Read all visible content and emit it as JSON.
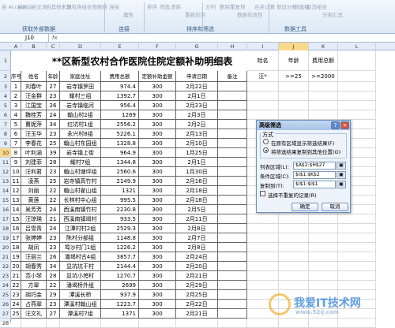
{
  "ribbon": {
    "row1": [
      "自 Access",
      "自网站",
      "自文本",
      "自其他来源",
      "现有连接",
      "全部刷新",
      "连接",
      "属性",
      "排序",
      "筛选",
      "清除",
      "重新应用",
      "分列",
      "删除重复项",
      "数据有效性",
      "合并计算",
      "假设分析",
      "创建组",
      "取消组合",
      "分类汇总"
    ],
    "groups": [
      "获取外部数据",
      "连接",
      "排序和筛选",
      "数据工具"
    ]
  },
  "formula_bar": {
    "name_box": "J10",
    "fx": "fx"
  },
  "columns": [
    "A",
    "B",
    "C",
    "D",
    "E",
    "F",
    "G",
    "H",
    "I",
    "J",
    "K",
    "L"
  ],
  "rows": [
    "1",
    "2",
    "3",
    "4",
    "5",
    "6",
    "7",
    "8",
    "9",
    "10",
    "11",
    "12",
    "13",
    "14",
    "15",
    "16",
    "17",
    "18",
    "19",
    "20",
    "21",
    "22",
    "23",
    "24",
    "25",
    "26",
    "27",
    "28"
  ],
  "sheet_title": "**区新型农村合作医院住院定额补助明细表",
  "table_headers": [
    "序号",
    "姓名",
    "年龄",
    "家庭住址",
    "费用总额",
    "定额补助金额",
    "申请日期",
    "备注"
  ],
  "table_rows": [
    [
      "1",
      "刘春叶",
      "27",
      "岩寺镇罗田",
      "974.4",
      "300",
      "2月22日",
      ""
    ],
    [
      "2",
      "汪金群",
      "23",
      "耀村三组",
      "1392.7",
      "300",
      "2月1日",
      ""
    ],
    [
      "3",
      "江国宝",
      "26",
      "岩寺镇临河",
      "956.4",
      "300",
      "2月23日",
      ""
    ],
    [
      "4",
      "魏桂芳",
      "24",
      "翰山村2组",
      "1269",
      "300",
      "2月3日",
      ""
    ],
    [
      "5",
      "曹妮萍",
      "34",
      "红坑村1组",
      "2556.2",
      "300",
      "2月2日",
      ""
    ],
    [
      "6",
      "汪玉华",
      "23",
      "永兴村8组",
      "5226.1",
      "300",
      "2月13日",
      ""
    ],
    [
      "7",
      "李春花",
      "25",
      "翰山村东园组",
      "1328.8",
      "300",
      "2月10日",
      ""
    ],
    [
      "8",
      "叶利涵",
      "39",
      "岩寺镇上街",
      "964.9",
      "300",
      "1月25日",
      ""
    ],
    [
      "9",
      "刘建菲",
      "28",
      "耀村7组",
      "1344.8",
      "300",
      "2月1日",
      ""
    ],
    [
      "10",
      "汪利君",
      "23",
      "翰山村塘坪组",
      "2560.6",
      "300",
      "1月30日",
      ""
    ],
    [
      "11",
      "凌燕",
      "25",
      "岩寺镇高竹村",
      "2149.9",
      "300",
      "2月16日",
      ""
    ],
    [
      "12",
      "刘丽",
      "22",
      "翰山村翟山组",
      "1321",
      "300",
      "2月18日",
      ""
    ],
    [
      "13",
      "黄莲",
      "22",
      "长林村中心组",
      "995.5",
      "300",
      "2月18日",
      ""
    ],
    [
      "14",
      "吴芳芳",
      "24",
      "西溪南镇竹村",
      "2230.8",
      "300",
      "2月5日",
      ""
    ],
    [
      "15",
      "汪琼瑛",
      "21",
      "西溪南镇堨村",
      "933.5",
      "300",
      "2月11日",
      ""
    ],
    [
      "16",
      "吕雪青",
      "24",
      "江潭村村2组",
      "2529.3",
      "300",
      "2月8日",
      ""
    ],
    [
      "17",
      "张婷婷",
      "23",
      "陈村分部组",
      "1148.8",
      "300",
      "2月7日",
      ""
    ],
    [
      "18",
      "胡凤",
      "23",
      "埠沙村门1组",
      "1226.2",
      "300",
      "2月8日",
      ""
    ],
    [
      "19",
      "汪丽兰",
      "26",
      "潘堨村古4组",
      "3857.7",
      "300",
      "2月24日",
      ""
    ],
    [
      "20",
      "胡春秀",
      "34",
      "显坑坑干村",
      "2144.4",
      "300",
      "2月20日",
      ""
    ],
    [
      "21",
      "范小琴",
      "28",
      "显坑小垮村",
      "1270.7",
      "300",
      "2月21日",
      ""
    ],
    [
      "22",
      "方翠",
      "22",
      "潘堨桥外组",
      "2699",
      "300",
      "2月29日",
      ""
    ],
    [
      "23",
      "胡巧金",
      "29",
      "潭溪长桥",
      "937.9",
      "300",
      "2月25日",
      ""
    ],
    [
      "24",
      "占燕翠",
      "23",
      "潭溪村翰山组",
      "1223.7",
      "300",
      "2月22日",
      ""
    ],
    [
      "25",
      "汪文礼",
      "27",
      "潭溪村7组",
      "1371",
      "300",
      "2月21日",
      ""
    ]
  ],
  "criteria": {
    "headers": [
      "姓名",
      "年龄",
      "费用总额"
    ],
    "values": [
      "汪*",
      ">=25",
      ">=2000"
    ]
  },
  "dialog": {
    "title": "高级筛选",
    "help": "?",
    "close": "×",
    "method_label": "方式",
    "opt1": "在原有区域显示筛选结果(F)",
    "opt2": "将筛选结果复制到其他位置(O)",
    "list_label": "列表区域(L):",
    "list_value": "$A$2:$H$27",
    "crit_label": "条件区域(C):",
    "crit_value": "$I$1:$K$2",
    "copy_label": "复制到(T):",
    "copy_value": "$I$1:$I$1",
    "unique_label": "选择不重复的记录(R)",
    "ok": "确定",
    "cancel": "取消"
  },
  "watermark": {
    "text": "我爱IT技术网",
    "url": "www.52ij.com"
  }
}
